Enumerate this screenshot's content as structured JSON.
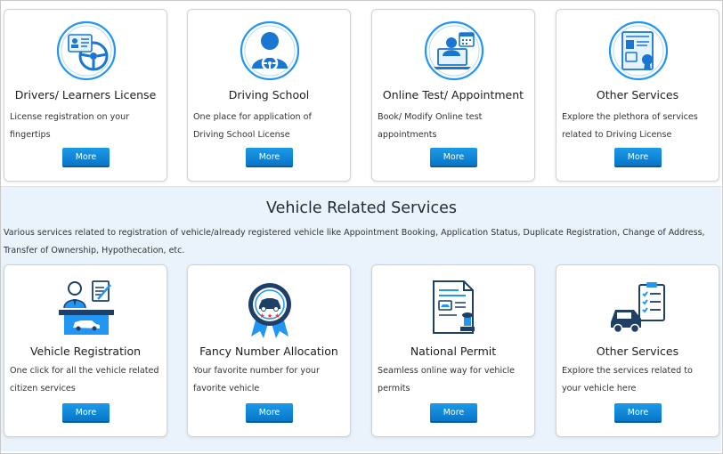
{
  "top_cards": [
    {
      "title": "Drivers/ Learners License",
      "description": "License registration on your fingertips",
      "button": "More",
      "icon": "license-steering-icon"
    },
    {
      "title": "Driving School",
      "description": "One place for application of Driving School License",
      "button": "More",
      "icon": "driver-person-icon"
    },
    {
      "title": "Online Test/ Appointment",
      "description": "Book/ Modify Online test appointments",
      "button": "More",
      "icon": "laptop-calendar-icon"
    },
    {
      "title": "Other Services",
      "description": "Explore the plethora of services related to Driving License",
      "button": "More",
      "icon": "certificate-icon"
    }
  ],
  "vehicle_section": {
    "title": "Vehicle Related Services",
    "description": "Various services related to registration of vehicle/already registered vehicle like Appointment Booking, Application Status, Duplicate Registration, Change of Address, Transfer of Ownership, Hypothecation, etc."
  },
  "vehicle_cards": [
    {
      "title": "Vehicle Registration",
      "description": "One click for all the vehicle related citizen services",
      "button": "More",
      "icon": "registration-officer-icon"
    },
    {
      "title": "Fancy Number Allocation",
      "description": "Your favorite number for your favorite vehicle",
      "button": "More",
      "icon": "car-badge-icon"
    },
    {
      "title": "National Permit",
      "description": "Seamless online way for vehicle permits",
      "button": "More",
      "icon": "permit-stamp-icon"
    },
    {
      "title": "Other Services",
      "description": "Explore the services related to your vehicle here",
      "button": "More",
      "icon": "car-checklist-icon"
    }
  ],
  "colors": {
    "accent_blue": "#2196f3",
    "button_blue": "#0a76c8",
    "section_band": "#eaf3fb",
    "dark_navy": "#1e3f66"
  }
}
